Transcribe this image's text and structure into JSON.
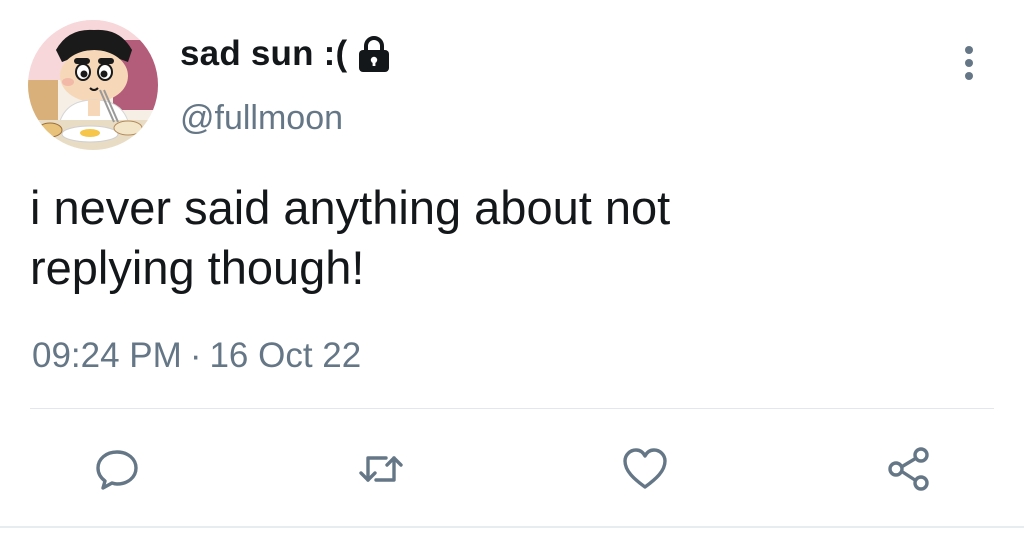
{
  "user": {
    "display_name": "sad sun :(",
    "handle": "@fullmoon",
    "avatar_icon": "cartoon-boy-avatar",
    "protected_icon": "lock-icon"
  },
  "tweet": {
    "text": "i never said anything about not\nreplying though!",
    "time": "09:24 PM",
    "separator": "·",
    "date": "16 Oct 22"
  },
  "actions": {
    "reply_icon": "reply-icon",
    "retweet_icon": "retweet-icon",
    "like_icon": "heart-icon",
    "share_icon": "share-icon",
    "more_icon": "more-vertical-icon"
  },
  "colors": {
    "text": "#14171a",
    "secondary": "#657786",
    "divider": "#e1e8ed"
  }
}
